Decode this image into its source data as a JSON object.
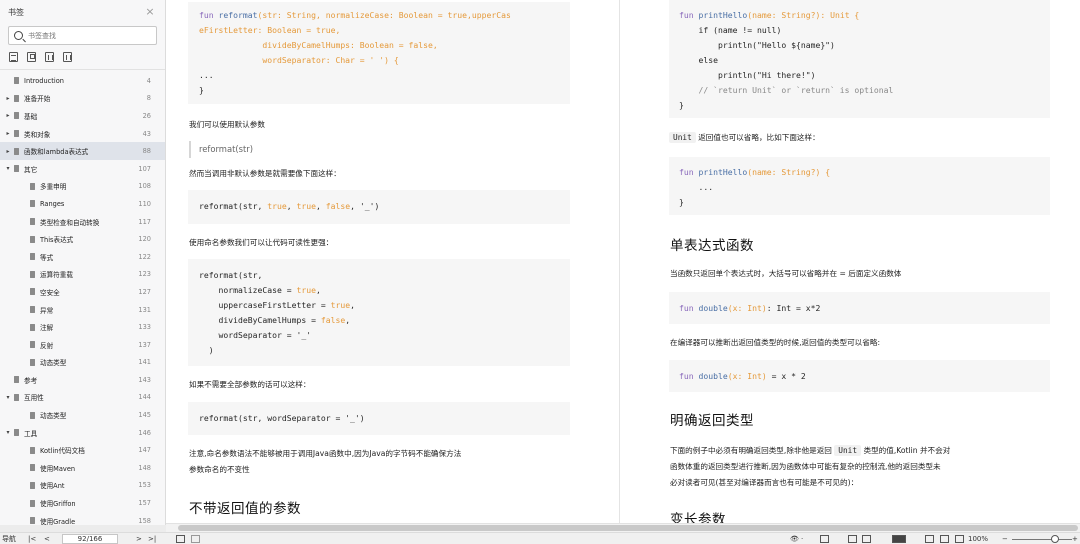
{
  "sidebar": {
    "title": "书签",
    "close_glyph": "×",
    "search_placeholder": "书签查找",
    "toc": [
      {
        "label": "Introduction",
        "page": "4",
        "level": 0,
        "expander": ""
      },
      {
        "label": "准备开始",
        "page": "8",
        "level": 0,
        "expander": "collapsed"
      },
      {
        "label": "基础",
        "page": "26",
        "level": 0,
        "expander": "collapsed"
      },
      {
        "label": "类和对象",
        "page": "43",
        "level": 0,
        "expander": "collapsed"
      },
      {
        "label": "函数和lambda表达式",
        "page": "88",
        "level": 0,
        "expander": "collapsed",
        "active": true
      },
      {
        "label": "其它",
        "page": "107",
        "level": 0,
        "expander": "expanded"
      },
      {
        "label": "多重申明",
        "page": "108",
        "level": 1,
        "expander": ""
      },
      {
        "label": "Ranges",
        "page": "110",
        "level": 1,
        "expander": ""
      },
      {
        "label": "类型检查和自动转换",
        "page": "117",
        "level": 1,
        "expander": ""
      },
      {
        "label": "This表达式",
        "page": "120",
        "level": 1,
        "expander": ""
      },
      {
        "label": "等式",
        "page": "122",
        "level": 1,
        "expander": ""
      },
      {
        "label": "运算符重载",
        "page": "123",
        "level": 1,
        "expander": ""
      },
      {
        "label": "空安全",
        "page": "127",
        "level": 1,
        "expander": ""
      },
      {
        "label": "异常",
        "page": "131",
        "level": 1,
        "expander": ""
      },
      {
        "label": "注解",
        "page": "133",
        "level": 1,
        "expander": ""
      },
      {
        "label": "反射",
        "page": "137",
        "level": 1,
        "expander": ""
      },
      {
        "label": "动态类型",
        "page": "141",
        "level": 1,
        "expander": ""
      },
      {
        "label": "参考",
        "page": "143",
        "level": 0,
        "expander": ""
      },
      {
        "label": "互用性",
        "page": "144",
        "level": 0,
        "expander": "expanded"
      },
      {
        "label": "动态类型",
        "page": "145",
        "level": 1,
        "expander": ""
      },
      {
        "label": "工具",
        "page": "146",
        "level": 0,
        "expander": "expanded"
      },
      {
        "label": "Kotlin代码文档",
        "page": "147",
        "level": 1,
        "expander": ""
      },
      {
        "label": "使用Maven",
        "page": "148",
        "level": 1,
        "expander": ""
      },
      {
        "label": "使用Ant",
        "page": "153",
        "level": 1,
        "expander": ""
      },
      {
        "label": "使用Griffon",
        "page": "157",
        "level": 1,
        "expander": ""
      },
      {
        "label": "使用Gradle",
        "page": "158",
        "level": 1,
        "expander": ""
      }
    ]
  },
  "left_page": {
    "code1": {
      "l1a": "fun ",
      "l1b": "reformat",
      "l1c": "(str: String, normalizeCase: Boolean = true,upperCas",
      "l2": "eFirstLetter: Boolean = true,",
      "l3": "             divideByCamelHumps: Boolean = false,",
      "l4": "             wordSeparator: Char = ' ') {",
      "l5": "...",
      "l6": "}"
    },
    "p1": "我们可以使用默认参数",
    "quote1": "reformat(str)",
    "p2": "然而当调用非默认参数是就需要像下面这样：",
    "code2": {
      "a": "reformat(str, ",
      "b": "true",
      "c": ", ",
      "d": "true",
      "e": ", ",
      "f": "false",
      "g": ", '_')"
    },
    "p3": "使用命名参数我们可以让代码可读性更强：",
    "code3": {
      "l1": "reformat(str,",
      "l2a": "    normalizeCase = ",
      "l2b": "true",
      "l2c": ",",
      "l3a": "    uppercaseFirstLetter = ",
      "l3b": "true",
      "l3c": ",",
      "l4a": "    divideByCamelHumps = ",
      "l4b": "false",
      "l4c": ",",
      "l5": "    wordSeparator = '_'",
      "l6": "  )"
    },
    "p4": "如果不需要全部参数的话可以这样：",
    "code4": "reformat(str, wordSeparator = '_')",
    "p5_1": "注意,命名参数语法不能够被用于调用Java函数中,因为Java的字节码不能确保方法",
    "p5_2": "参数命名的不变性",
    "h_noret": "不带返回值的参数"
  },
  "right_page": {
    "code1": {
      "l1a": "fun ",
      "l1b": "printHello",
      "l1c": "(name: String?): Unit {",
      "l2": "    if (name != null)",
      "l3": "        println(\"Hello ${name}\")",
      "l4": "    else",
      "l5": "        println(\"Hi there!\")",
      "l6": "    // `return Unit` or `return` is optional",
      "l7": "}"
    },
    "p1_code": "Unit",
    "p1_text": "返回值也可以省略，比如下面这样：",
    "code2": {
      "l1a": "fun ",
      "l1b": "printHello",
      "l1c": "(name: String?) {",
      "l2": "    ...",
      "l3": "}"
    },
    "h_single": "单表达式函数",
    "p2": "当函数只返回单个表达式时，大括号可以省略并在 = 后面定义函数体",
    "code3": {
      "a": "fun ",
      "b": "double",
      "c": "(x: Int)",
      "d": ": Int = x*2"
    },
    "p3": "在编译器可以推断出返回值类型的时候,返回值的类型可以省略:",
    "code4": {
      "a": "fun ",
      "b": "double",
      "c": "(x: Int)",
      "d": " = x * 2"
    },
    "h_explicit": "明确返回类型",
    "p4_1a": "下面的例子中必须有明确返回类型,除非他是返回 ",
    "p4_1code": "Unit",
    "p4_1b": " 类型的值,Kotlin 并不会对",
    "p4_2": "函数体重的返回类型进行推断,因为函数体中可能有复杂的控制流,他的返回类型未",
    "p4_3": "必对读者可见(甚至对编译器而言也有可能是不可见的)：",
    "h_vararg": "变长参数"
  },
  "statusbar": {
    "nav_label": "导航",
    "page_value": "92/166",
    "zoom": "100%",
    "zoom_minus": "−",
    "zoom_plus": "+",
    "first": "|<",
    "prev": "<",
    "next": ">",
    "last": ">|",
    "eye": "👁",
    "eye_caret": "·"
  },
  "colors": {
    "keyword": "#8a6abc",
    "function": "#4a6fa5",
    "literal": "#e59a3b",
    "active_row": "#dfe3ea"
  }
}
